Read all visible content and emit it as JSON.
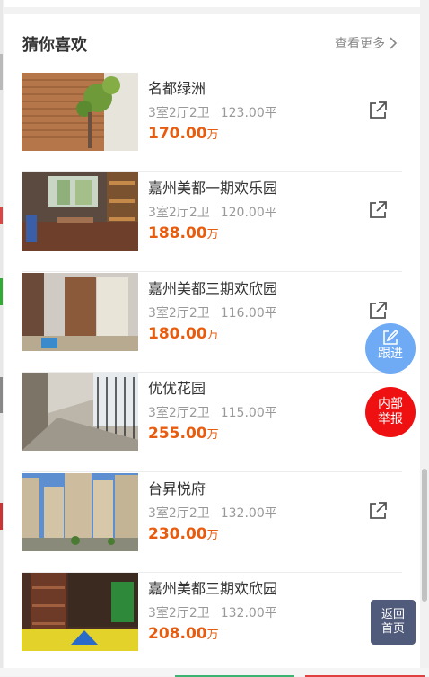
{
  "section": {
    "title": "猜你喜欢",
    "more": "查看更多"
  },
  "listings": [
    {
      "name": "名都绿洲",
      "layout": "3室2厅2卫",
      "area": "123.00平",
      "price": "170.00",
      "unit": "万"
    },
    {
      "name": "嘉州美都一期欢乐园",
      "layout": "3室2厅2卫",
      "area": "120.00平",
      "price": "188.00",
      "unit": "万"
    },
    {
      "name": "嘉州美都三期欢欣园",
      "layout": "3室2厅2卫",
      "area": "116.00平",
      "price": "180.00",
      "unit": "万"
    },
    {
      "name": "优优花园",
      "layout": "3室2厅2卫",
      "area": "115.00平",
      "price": "255.00",
      "unit": "万"
    },
    {
      "name": "台昇悦府",
      "layout": "3室2厅2卫",
      "area": "132.00平",
      "price": "230.00",
      "unit": "万"
    },
    {
      "name": "嘉州美都三期欢欣园",
      "layout": "3室2厅2卫",
      "area": "132.00平",
      "price": "208.00",
      "unit": "万"
    }
  ],
  "floating": {
    "follow": "跟进",
    "report_line1": "内部",
    "report_line2": "举报",
    "home_line1": "返回",
    "home_line2": "首页"
  },
  "colors": {
    "price": "#e85c0f",
    "follow": "#6faaf5",
    "report": "#ef1111",
    "home": "#505a7a"
  },
  "icons": {
    "share": "share-external-icon",
    "more": "chevron-right-icon",
    "follow": "edit-icon"
  }
}
